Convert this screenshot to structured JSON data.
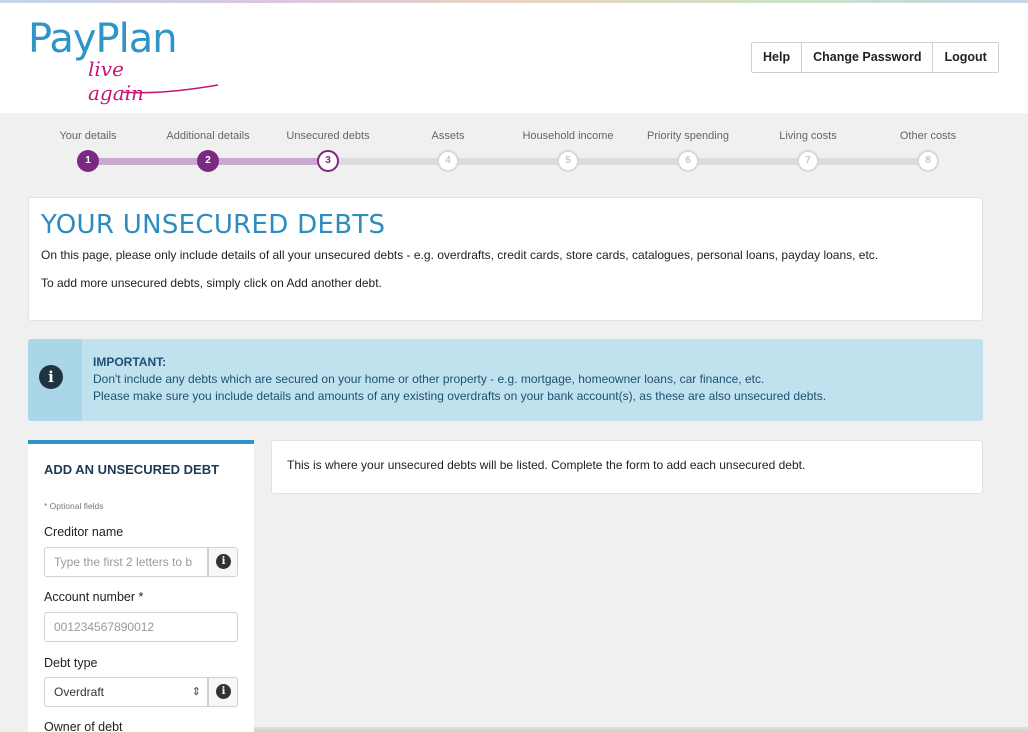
{
  "header": {
    "logo_text": "PayPlan",
    "logo_tagline": "live again",
    "buttons": {
      "help": "Help",
      "change_password": "Change Password",
      "logout": "Logout"
    }
  },
  "progress": {
    "steps": [
      {
        "label": "Your details",
        "number": "1",
        "state": "done"
      },
      {
        "label": "Additional details",
        "number": "2",
        "state": "done"
      },
      {
        "label": "Unsecured debts",
        "number": "3",
        "state": "current"
      },
      {
        "label": "Assets",
        "number": "4",
        "state": "todo"
      },
      {
        "label": "Household income",
        "number": "5",
        "state": "todo"
      },
      {
        "label": "Priority spending",
        "number": "6",
        "state": "todo"
      },
      {
        "label": "Living costs",
        "number": "7",
        "state": "todo"
      },
      {
        "label": "Other costs",
        "number": "8",
        "state": "todo"
      }
    ]
  },
  "intro": {
    "title": "YOUR UNSECURED DEBTS",
    "line1": "On this page, please only include details of all your unsecured debts - e.g. overdrafts, credit cards, store cards, catalogues, personal loans, payday loans, etc.",
    "line2": "To add more unsecured debts, simply click on Add another debt."
  },
  "notice": {
    "icon": "info-icon",
    "title": "IMPORTANT:",
    "line1": "Don't include any debts which are secured on your home or other property - e.g. mortgage, homeowner loans, car finance, etc.",
    "line2": "Please make sure you include details and amounts of any existing overdrafts on your bank account(s), as these are also unsecured debts."
  },
  "form": {
    "title": "ADD AN UNSECURED DEBT",
    "optional_note": "* Optional fields",
    "creditor_label": "Creditor name",
    "creditor_placeholder": "Type the first 2 letters to b",
    "account_label": "Account number *",
    "account_placeholder": "001234567890012",
    "debt_type_label": "Debt type",
    "debt_type_value": "Overdraft",
    "owner_label": "Owner of debt"
  },
  "list": {
    "empty_text": "This is where your unsecured debts will be listed. Complete the form to add each unsecured debt."
  },
  "colors": {
    "brand_blue": "#2d95c7",
    "brand_purple": "#7a2a80",
    "brand_pink": "#c2187a",
    "notice_bg": "#bfe2ee"
  }
}
